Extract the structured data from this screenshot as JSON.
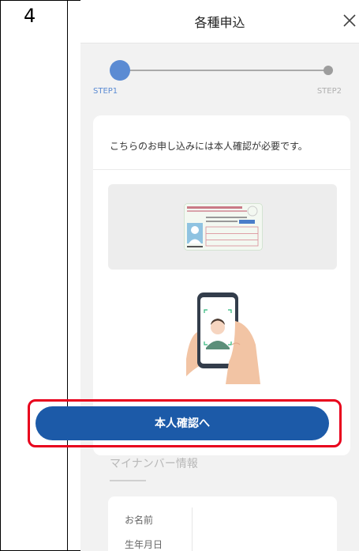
{
  "step_number": "4",
  "header": {
    "title": "各種申込"
  },
  "stepper": {
    "step1_label": "STEP1",
    "step2_label": "STEP2"
  },
  "notice": "こちらのお申し込みには本人確認が必要です。",
  "confirm_button": "本人確認へ",
  "mynumber": {
    "title": "マイナンバー情報",
    "fields": {
      "name": "お名前",
      "dob": "生年月日"
    }
  },
  "icons": {
    "close": "close-icon"
  },
  "colors": {
    "primary": "#1c5aa8",
    "step_active": "#5b8bd3",
    "highlight": "#e8001c"
  }
}
